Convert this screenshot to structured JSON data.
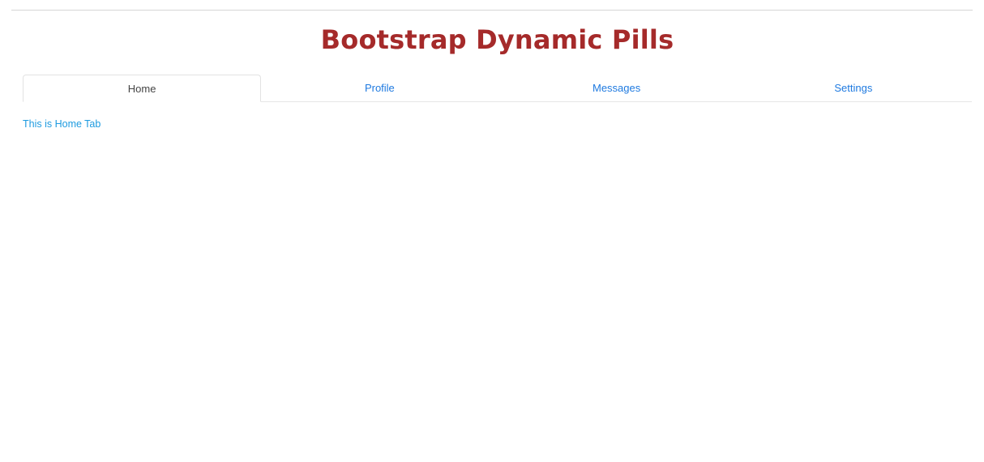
{
  "header": {
    "title": "Bootstrap Dynamic Pills"
  },
  "tabs": [
    {
      "label": "Home",
      "active": true
    },
    {
      "label": "Profile",
      "active": false
    },
    {
      "label": "Messages",
      "active": false
    },
    {
      "label": "Settings",
      "active": false
    }
  ],
  "content": {
    "text": "This is Home Tab"
  },
  "colors": {
    "title": "#a52a2a",
    "link": "#1f7ae0",
    "content_text": "#1e9be0",
    "active_tab_text": "#444444"
  }
}
